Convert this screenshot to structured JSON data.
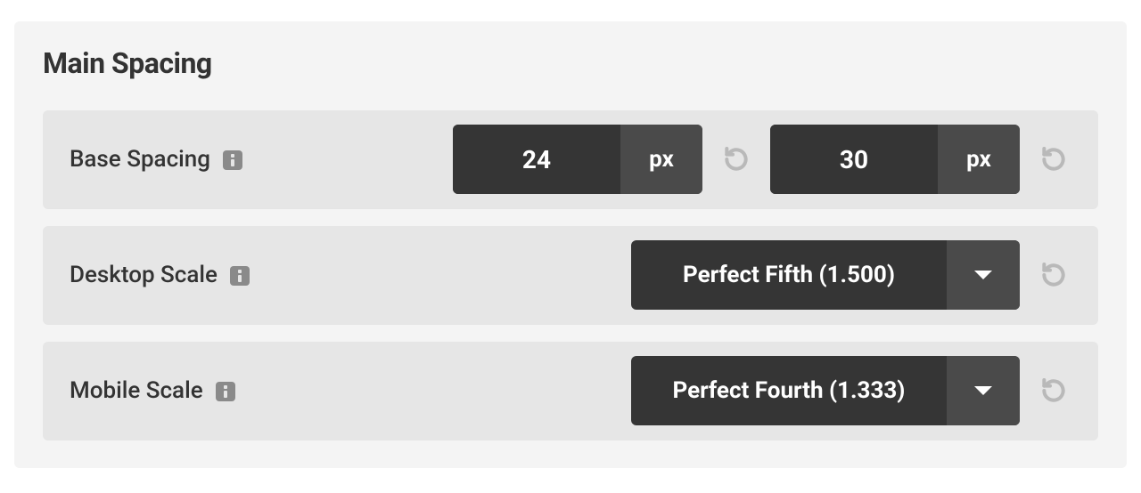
{
  "panel": {
    "title": "Main Spacing"
  },
  "rows": {
    "base_spacing": {
      "label": "Base Spacing",
      "value1": "24",
      "unit1": "px",
      "value2": "30",
      "unit2": "px"
    },
    "desktop_scale": {
      "label": "Desktop Scale",
      "selected": "Perfect Fifth (1.500)"
    },
    "mobile_scale": {
      "label": "Mobile Scale",
      "selected": "Perfect Fourth (1.333)"
    }
  }
}
